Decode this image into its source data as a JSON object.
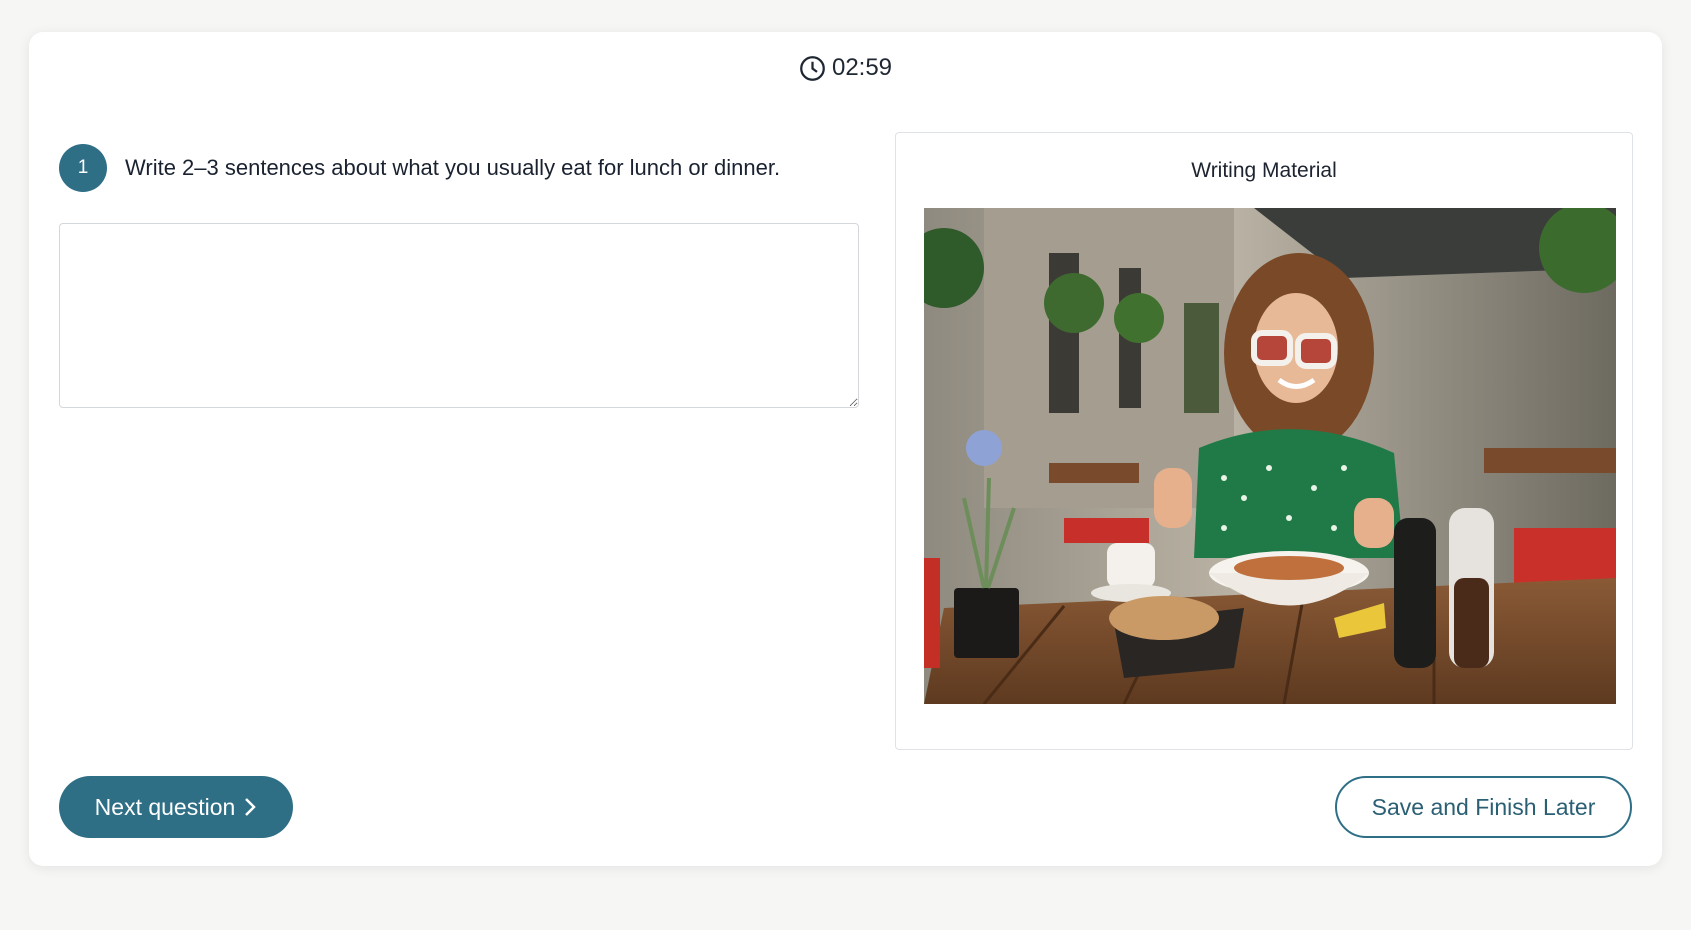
{
  "timer": {
    "value": "02:59",
    "icon": "clock-icon"
  },
  "question": {
    "number": "1",
    "text": "Write 2–3 sentences about what you usually eat for lunch or dinner."
  },
  "answer": {
    "value": "",
    "placeholder": ""
  },
  "material": {
    "title": "Writing Material",
    "image_alt": "Woman in white sunglasses and green dress eating a pasta dish at an outdoor cafe table"
  },
  "actions": {
    "next_label": "Next question",
    "save_label": "Save and Finish Later"
  },
  "colors": {
    "accent": "#2e6f86",
    "background": "#f6f6f5",
    "card": "#ffffff"
  }
}
